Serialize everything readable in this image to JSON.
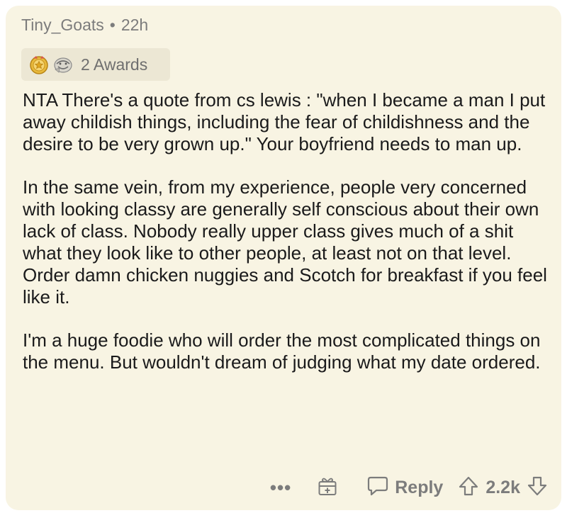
{
  "comment": {
    "author": "Tiny_Goats",
    "separator": "•",
    "age": "22h",
    "awards": {
      "label": "2 Awards",
      "icons": [
        "silver-award-icon",
        "wholesome-award-icon"
      ]
    },
    "paragraphs": [
      "NTA There's a quote from cs lewis : \"when I became a man I put away childish things, including the fear of childishness and the desire to be very grown up.\" Your boyfriend needs to man up.",
      "In the same vein, from my experience, people very concerned with looking classy are generally self conscious about their own lack of class. Nobody really upper class gives much of a shit what they look like to other people, at least not on that level. Order damn chicken nuggies and Scotch for breakfast if you feel like it.",
      "I'm a huge foodie who will order the most complicated things on the menu. But wouldn't dream of judging what my date ordered."
    ]
  },
  "actions": {
    "more_label": "•••",
    "give_award_icon": "gift-icon",
    "reply_label": "Reply",
    "score": "2.2k"
  },
  "colors": {
    "card_background": "#f8f4e3",
    "text": "#1a1a1b",
    "muted": "#7c7c7c",
    "awards_background": "#ece7d4"
  }
}
